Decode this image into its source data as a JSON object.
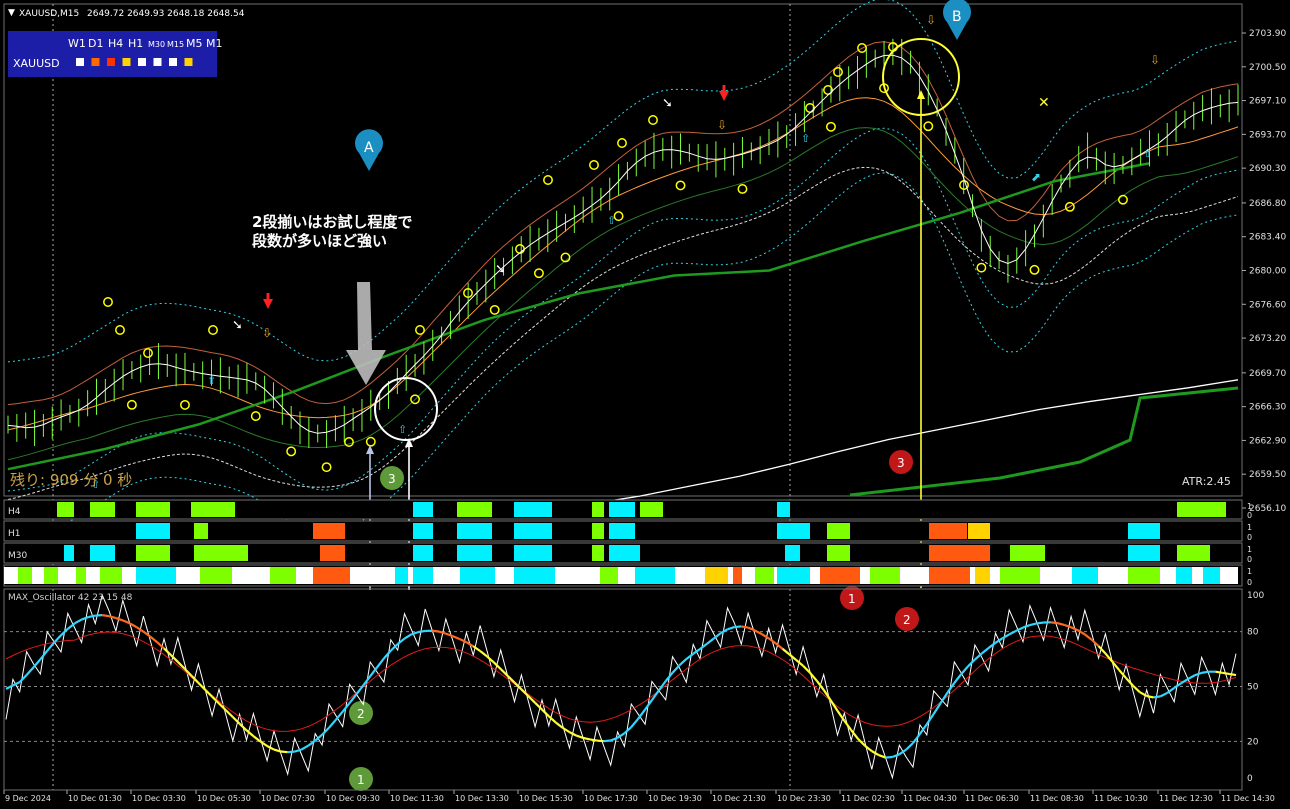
{
  "header": {
    "symbol_text": "XAUUSD,M15",
    "ohlc": "2649.72 2649.93 2648.18 2648.54"
  },
  "panel": {
    "timeframes": [
      {
        "label": "W1",
        "color": "#ffffff"
      },
      {
        "label": "D1",
        "color": "#ff6a00"
      },
      {
        "label": "H4",
        "color": "#ff3300"
      },
      {
        "label": "H1",
        "color": "#ffd200"
      },
      {
        "label": "M30",
        "color": "#ffffff"
      },
      {
        "label": "M15",
        "color": "#ffffff"
      },
      {
        "label": "M5",
        "color": "#ffffff"
      },
      {
        "label": "M1",
        "color": "#ffd200"
      }
    ],
    "symbol": "XAUUSD"
  },
  "annotations": {
    "note_line1": "2段揃いはお試し程度で",
    "note_line2": "段数が多いほど強い",
    "marker_a": "A",
    "marker_b": "B",
    "circle_1_top": "1",
    "circle_2_top": "2",
    "circle_3_top": "3",
    "circle_1_bottom": "1",
    "circle_2_bottom": "2",
    "circle_3_bottom": "3"
  },
  "countdown_text": "残り: 909 分 0 秒",
  "atr_text": "ATR:2.45",
  "price_axis": [
    "2703.90",
    "2700.50",
    "2697.10",
    "2693.70",
    "2690.30",
    "2686.80",
    "2683.40",
    "2680.00",
    "2676.60",
    "2673.20",
    "2669.70",
    "2666.30",
    "2662.90",
    "2659.50",
    "2656.10"
  ],
  "strip_labels": [
    "H4",
    "H1",
    "M30",
    ""
  ],
  "strip_axis": [
    "1",
    "0"
  ],
  "oscillator": {
    "title": "MAX_Oscillator 42 23 15 48",
    "axis": [
      "100",
      "80",
      "50",
      "20",
      "0"
    ]
  },
  "time_axis": [
    "9 Dec 2024",
    "10 Dec 01:30",
    "10 Dec 03:30",
    "10 Dec 05:30",
    "10 Dec 07:30",
    "10 Dec 09:30",
    "10 Dec 11:30",
    "10 Dec 13:30",
    "10 Dec 15:30",
    "10 Dec 17:30",
    "10 Dec 19:30",
    "10 Dec 21:30",
    "10 Dec 23:30",
    "11 Dec 02:30",
    "11 Dec 04:30",
    "11 Dec 06:30",
    "11 Dec 08:30",
    "11 Dec 10:30",
    "11 Dec 12:30",
    "11 Dec 14:30"
  ],
  "colors": {
    "background": "#000000",
    "candle": "#7dff3a",
    "upper_band": "#2fd3e8",
    "ma_white": "#ffffff",
    "ma_dark_green": "#1e9a1e",
    "ma_orange": "#ff9a3c",
    "strip_cyan": "#00f0ff",
    "strip_green": "#7dff00",
    "strip_orange": "#ff5a10",
    "strip_yellow": "#ffd200",
    "annotation_yellow": "#ffff33",
    "marker_blue": "#1b8ec2",
    "osc_white": "#ffffff",
    "osc_red": "#e01b1b",
    "osc_cyan": "#33d6ff",
    "osc_yellow": "#ffff33"
  },
  "chart_data": {
    "type": "line",
    "instrument": "XAUUSD",
    "timeframe": "M15",
    "ylim": [
      2656.1,
      2703.9
    ],
    "x_ticks": [
      "9 Dec 2024",
      "10 Dec 01:30",
      "10 Dec 03:30",
      "10 Dec 05:30",
      "10 Dec 07:30",
      "10 Dec 09:30",
      "10 Dec 11:30",
      "10 Dec 13:30",
      "10 Dec 15:30",
      "10 Dec 17:30",
      "10 Dec 19:30",
      "10 Dec 21:30",
      "10 Dec 23:30",
      "11 Dec 02:30",
      "11 Dec 04:30",
      "11 Dec 06:30",
      "11 Dec 08:30",
      "11 Dec 10:30",
      "11 Dec 12:30",
      "11 Dec 14:30"
    ],
    "price_close": [
      2664.5,
      2664.0,
      2665.2,
      2666.0,
      2668.3,
      2670.1,
      2670.8,
      2670.0,
      2669.5,
      2669.2,
      2668.8,
      2666.0,
      2663.5,
      2663.8,
      2665.5,
      2667.2,
      2670.0,
      2672.5,
      2676.0,
      2678.6,
      2681.0,
      2683.0,
      2684.5,
      2686.0,
      2688.0,
      2691.0,
      2692.3,
      2692.0,
      2691.0,
      2691.5,
      2692.3,
      2693.5,
      2696.0,
      2698.5,
      2700.5,
      2702.0,
      2701.0,
      2696.5,
      2690.0,
      2682.0,
      2680.0,
      2684.0,
      2689.0,
      2692.0,
      2690.0,
      2691.5,
      2693.0,
      2695.5,
      2696.5,
      2697.0
    ],
    "series": [
      {
        "name": "MA long",
        "values": [
          2656.5,
          2657.3,
          2658.3,
          2659.3,
          2660.5,
          2661.8,
          2663.0,
          2664.0,
          2665.0,
          2666.0,
          2666.8,
          2667.5,
          2668.2,
          2669.0
        ]
      },
      {
        "name": "MA dark green",
        "values": [
          2660.0,
          2662.0,
          2664.5,
          2667.8,
          2671.5,
          2675.0,
          2677.7,
          2679.5,
          2680.0,
          2683.0,
          2685.8,
          2689.0,
          2690.8
        ]
      }
    ],
    "strips": {
      "rows": [
        "H4",
        "H1",
        "M30",
        "All"
      ],
      "states": [
        "cyan",
        "green",
        "orange",
        "yellow",
        "white",
        "black"
      ]
    },
    "oscillator": {
      "name": "MAX_Oscillator",
      "params": [
        42,
        23,
        15,
        48
      ],
      "ylim": [
        0,
        100
      ],
      "levels": [
        20,
        50,
        80
      ],
      "fast": [
        45,
        60,
        80,
        90,
        88,
        80,
        66,
        50,
        35,
        20,
        12,
        18,
        35,
        55,
        75,
        82,
        78,
        70,
        55,
        40,
        25,
        20,
        20,
        40,
        62,
        72,
        85,
        80,
        68,
        55,
        30,
        12,
        10,
        30,
        55,
        70,
        80,
        86,
        84,
        75,
        55,
        40,
        52,
        60,
        55
      ]
    }
  }
}
